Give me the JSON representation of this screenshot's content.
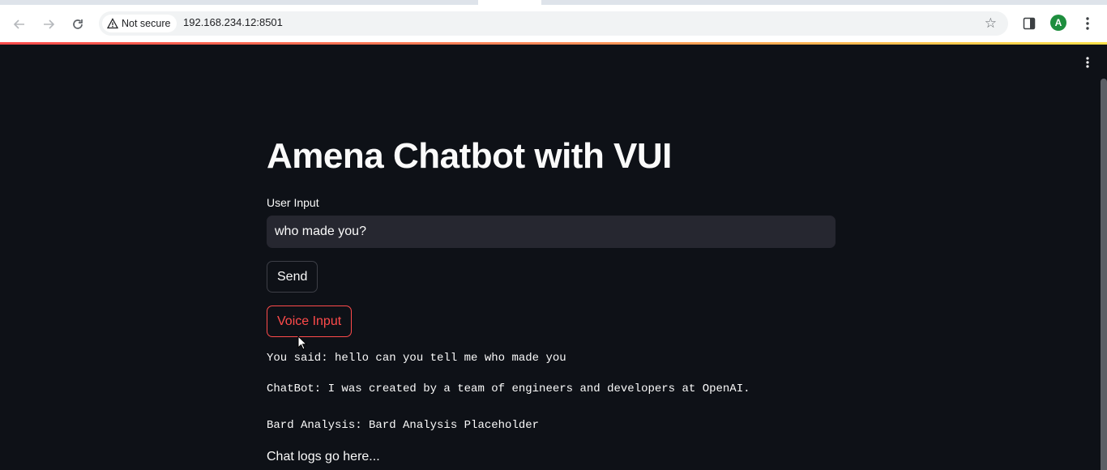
{
  "browser": {
    "security_label": "Not secure",
    "url": "192.168.234.12:8501",
    "profile_initial": "A"
  },
  "app": {
    "title": "Amena Chatbot with VUI",
    "input_label": "User Input",
    "input_value": "who made you?",
    "send_label": "Send",
    "voice_label": "Voice Input",
    "you_said": "You said: hello can you tell me who made you",
    "chatbot_reply": "ChatBot: I was created by a team of engineers and developers at OpenAI.",
    "bard_analysis": "Bard Analysis: Bard Analysis Placeholder",
    "chat_logs": "Chat logs go here..."
  },
  "colors": {
    "background": "#0e1117",
    "input_background": "#262730",
    "primary": "#ff4b4b",
    "text": "#fafafa"
  },
  "icons": [
    "back-icon",
    "forward-icon",
    "reload-icon",
    "warning-icon",
    "star-icon",
    "side-panel-icon",
    "profile-avatar",
    "menu-dots-icon",
    "app-menu-icon",
    "mouse-cursor"
  ]
}
